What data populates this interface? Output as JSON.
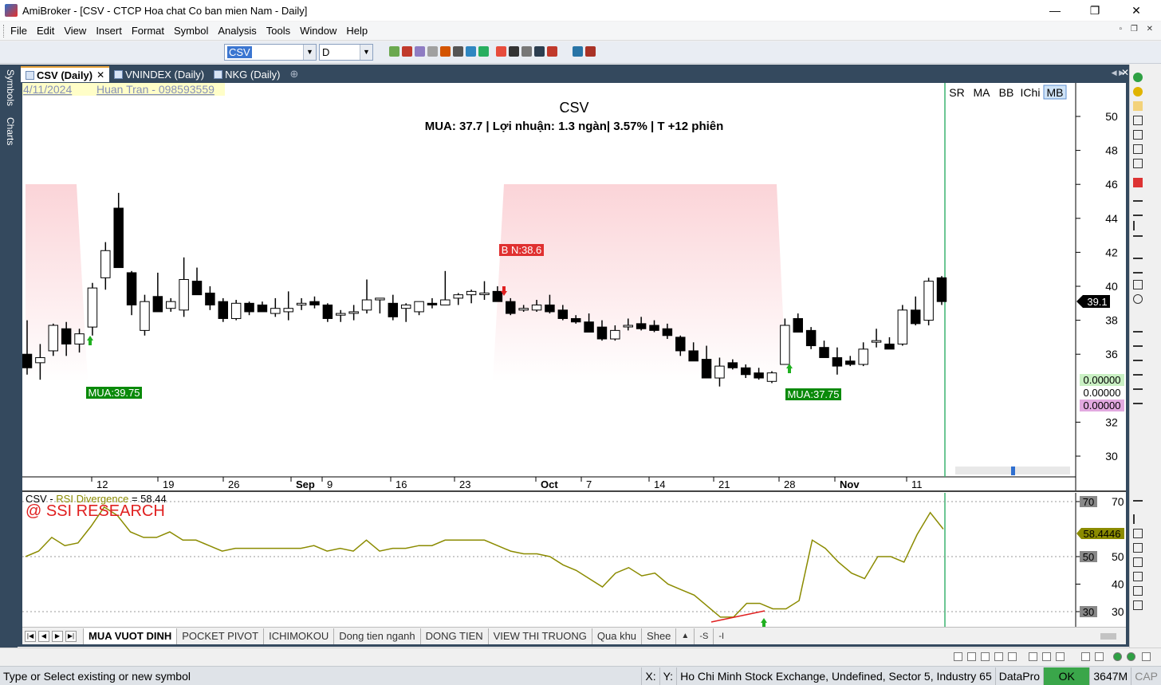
{
  "window": {
    "title": "AmiBroker - [CSV - CTCP Hoa chat Co ban mien Nam - Daily]",
    "minimize": "—",
    "maximize": "❐",
    "close": "✕"
  },
  "menu": [
    "File",
    "Edit",
    "View",
    "Insert",
    "Format",
    "Symbol",
    "Analysis",
    "Tools",
    "Window",
    "Help"
  ],
  "menu_mdi": "▫ ❐ ✕",
  "toolbar": {
    "symbol_value": "CSV",
    "interval_value": "D"
  },
  "left_strip": {
    "symbols": "Symbols",
    "charts": "Charts"
  },
  "tabs": [
    {
      "label": "CSV (Daily)",
      "active": true
    },
    {
      "label": "VNINDEX (Daily)",
      "active": false
    },
    {
      "label": "NKG (Daily)",
      "active": false
    }
  ],
  "tab_add": "⊕",
  "chart_data": {
    "type": "candlestick",
    "date_label": "4/11/2024",
    "author_label": "Huan Tran - 098593559",
    "title": "CSV",
    "subtitle": "MUA:  37.7  | Lợi nhuận: 1.3 ngàn| 3.57%  | T +12 phiên",
    "indicator_buttons": [
      "SR",
      "MA",
      "BB",
      "IChi",
      "MB"
    ],
    "price_axis": {
      "min": 29,
      "max": 51,
      "ticks": [
        30,
        32,
        34,
        36,
        38,
        40,
        42,
        44,
        46,
        48,
        50
      ]
    },
    "price_axis_labels": [
      "50",
      "48",
      "46",
      "44",
      "42",
      "40",
      "38",
      "36",
      "32",
      "30"
    ],
    "last_price_label": "39.1",
    "value_boxes": [
      {
        "text": "0.00000",
        "bg": "#c9f0c3"
      },
      {
        "text": "0.00000",
        "bg": "#ffffff"
      },
      {
        "text": "0.00000",
        "bg": "#e2a9e0"
      }
    ],
    "x_labels": [
      "12",
      "19",
      "26",
      "Sep",
      "9",
      "16",
      "23",
      "Oct",
      "7",
      "14",
      "21",
      "28",
      "Nov",
      "11"
    ],
    "candles": [
      [
        36.0,
        38.0,
        34.8,
        35.2
      ],
      [
        35.5,
        36.6,
        34.5,
        35.8
      ],
      [
        36.2,
        37.8,
        35.9,
        37.7
      ],
      [
        37.5,
        37.9,
        35.9,
        36.6
      ],
      [
        36.6,
        37.5,
        36.1,
        37.2
      ],
      [
        37.6,
        40.2,
        37.1,
        39.9
      ],
      [
        40.5,
        42.6,
        39.8,
        42.1
      ],
      [
        44.6,
        45.5,
        41.6,
        41.1
      ],
      [
        40.8,
        40.9,
        38.3,
        38.9
      ],
      [
        37.4,
        39.5,
        37.1,
        39.1
      ],
      [
        39.4,
        40.8,
        38.6,
        38.5
      ],
      [
        38.7,
        39.3,
        38.5,
        39.1
      ],
      [
        38.6,
        41.7,
        38.2,
        40.4
      ],
      [
        40.3,
        41.1,
        39.5,
        39.5
      ],
      [
        39.6,
        40.0,
        38.6,
        38.9
      ],
      [
        39.1,
        39.3,
        37.9,
        38.1
      ],
      [
        38.1,
        39.2,
        38.0,
        39.0
      ],
      [
        39.0,
        39.1,
        38.3,
        38.5
      ],
      [
        38.9,
        39.1,
        38.5,
        38.5
      ],
      [
        38.4,
        39.3,
        38.2,
        38.7
      ],
      [
        38.5,
        39.7,
        38.0,
        38.7
      ],
      [
        38.9,
        39.3,
        38.6,
        39.0
      ],
      [
        39.1,
        39.4,
        38.7,
        38.9
      ],
      [
        38.9,
        39.0,
        37.9,
        38.1
      ],
      [
        38.3,
        38.6,
        37.9,
        38.4
      ],
      [
        38.5,
        38.9,
        38.0,
        38.5
      ],
      [
        38.6,
        40.4,
        38.4,
        39.2
      ],
      [
        39.2,
        39.3,
        38.4,
        39.3
      ],
      [
        39.0,
        39.5,
        38.0,
        38.2
      ],
      [
        38.7,
        39.0,
        37.9,
        38.9
      ],
      [
        38.5,
        39.1,
        38.3,
        39.1
      ],
      [
        39.0,
        39.3,
        38.7,
        38.9
      ],
      [
        38.9,
        40.9,
        38.9,
        39.2
      ],
      [
        39.3,
        39.6,
        38.9,
        39.5
      ],
      [
        39.5,
        39.8,
        39.0,
        39.7
      ],
      [
        39.6,
        40.3,
        39.2,
        39.6
      ],
      [
        39.7,
        40.0,
        39.2,
        39.1
      ],
      [
        39.1,
        39.3,
        38.3,
        38.4
      ],
      [
        38.6,
        38.9,
        38.5,
        38.7
      ],
      [
        38.6,
        39.2,
        38.5,
        38.9
      ],
      [
        38.9,
        39.5,
        38.4,
        38.5
      ],
      [
        38.6,
        38.9,
        38.0,
        38.1
      ],
      [
        38.1,
        38.3,
        37.8,
        37.9
      ],
      [
        37.9,
        38.4,
        37.3,
        37.3
      ],
      [
        37.6,
        38.0,
        36.8,
        36.9
      ],
      [
        36.9,
        37.7,
        36.8,
        37.4
      ],
      [
        37.7,
        38.1,
        37.4,
        37.7
      ],
      [
        37.8,
        38.2,
        37.4,
        37.5
      ],
      [
        37.7,
        38.0,
        37.3,
        37.4
      ],
      [
        37.5,
        37.8,
        36.9,
        37.1
      ],
      [
        37.0,
        37.1,
        35.9,
        36.2
      ],
      [
        36.2,
        36.7,
        35.6,
        35.6
      ],
      [
        35.7,
        36.5,
        34.7,
        34.6
      ],
      [
        34.6,
        35.8,
        34.1,
        35.3
      ],
      [
        35.5,
        35.7,
        35.1,
        35.2
      ],
      [
        35.2,
        35.4,
        34.6,
        34.8
      ],
      [
        34.9,
        35.2,
        34.5,
        34.6
      ],
      [
        34.4,
        35.0,
        34.3,
        34.9
      ],
      [
        35.4,
        38.1,
        35.4,
        37.7
      ],
      [
        38.1,
        38.4,
        37.3,
        37.3
      ],
      [
        37.4,
        37.6,
        36.3,
        36.5
      ],
      [
        36.4,
        36.8,
        35.8,
        35.8
      ],
      [
        35.8,
        36.4,
        34.8,
        35.3
      ],
      [
        35.6,
        35.9,
        35.3,
        35.4
      ],
      [
        35.4,
        36.7,
        35.3,
        36.3
      ],
      [
        36.8,
        37.5,
        36.4,
        36.8
      ],
      [
        36.6,
        37.0,
        36.4,
        36.3
      ],
      [
        36.6,
        38.9,
        36.5,
        38.6
      ],
      [
        38.6,
        39.4,
        37.7,
        37.8
      ],
      [
        38.0,
        40.5,
        37.7,
        40.3
      ],
      [
        40.5,
        40.6,
        38.9,
        39.1
      ]
    ],
    "signals": [
      {
        "label": "MUA:39.75",
        "type": "buy"
      },
      {
        "label": "B N:38.6",
        "type": "sell"
      },
      {
        "label": "MUA:37.75",
        "type": "buy"
      }
    ],
    "rsi": {
      "title_symbol": "CSV",
      "title_name": "RSI Divergence",
      "title_value": "= 58.44",
      "watermark": "@ SSI RESEARCH",
      "axis": {
        "min": 24,
        "max": 76,
        "ticks": [
          30,
          40,
          50,
          60,
          70
        ]
      },
      "axis_labels": [
        "70",
        "50",
        "40",
        "30"
      ],
      "boxed_labels": [
        "70",
        "50",
        "30"
      ],
      "current_label": "58.4446",
      "values": [
        50,
        52,
        57,
        54,
        55,
        61,
        68,
        65,
        59,
        57,
        57,
        59,
        56,
        56,
        54,
        52,
        53,
        53,
        53,
        53,
        53,
        53,
        54,
        52,
        53,
        52,
        56,
        52,
        53,
        53,
        54,
        54,
        56,
        56,
        56,
        56,
        54,
        52,
        51,
        51,
        50,
        47,
        45,
        42,
        39,
        44,
        46,
        43,
        44,
        40,
        38,
        36,
        32,
        28,
        28,
        33,
        33,
        31,
        31,
        34,
        56,
        53,
        48,
        44,
        42,
        50,
        50,
        48,
        58,
        66,
        60
      ]
    }
  },
  "sheets": [
    "MUA VUOT DINH",
    "POCKET PIVOT",
    "ICHIMOKOU",
    "Dong tien nganh",
    "DONG TIEN",
    "VIEW THI TRUONG",
    "Qua khu",
    "Shee"
  ],
  "sheet_extra": [
    "-S",
    "-I"
  ],
  "status": {
    "hint": "Type or Select existing or new symbol",
    "x": "X:",
    "y": "Y:",
    "exchange": "Ho Chi Minh Stock Exchange, Undefined, Sector 5, Industry 65",
    "source": "DataPro",
    "ok": "OK",
    "memory": "3647M",
    "cap": "CAP"
  }
}
